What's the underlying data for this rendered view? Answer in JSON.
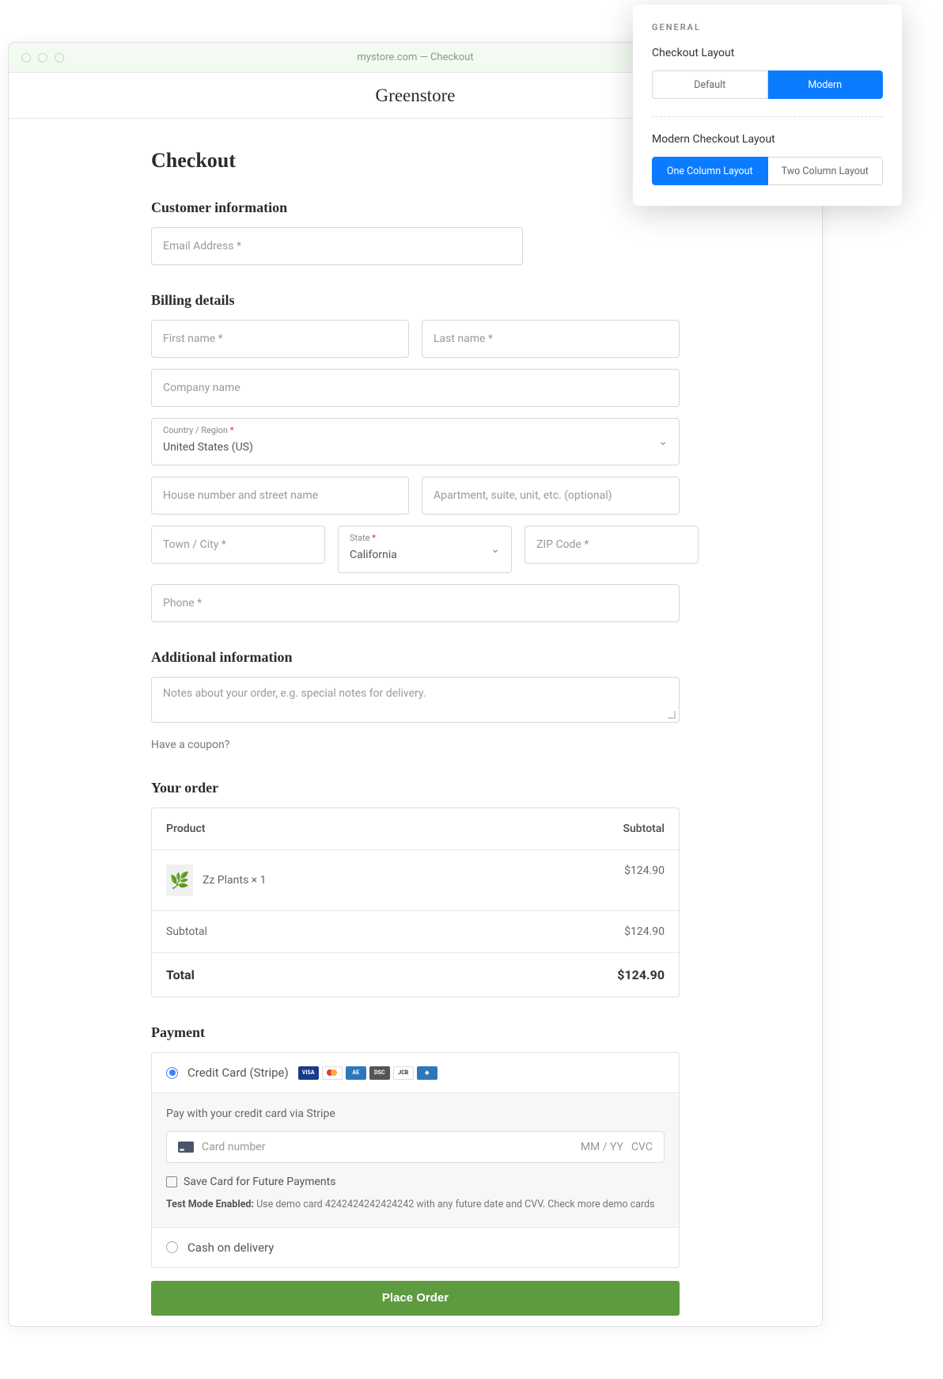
{
  "browser": {
    "url": "mystore.com — Checkout"
  },
  "store": {
    "name": "Greenstore"
  },
  "page": {
    "title": "Checkout"
  },
  "customer": {
    "heading": "Customer information",
    "email_placeholder": "Email Address *"
  },
  "billing": {
    "heading": "Billing details",
    "first_name": "First name *",
    "last_name": "Last name *",
    "company": "Company name",
    "country_label": "Country / Region",
    "country_value": "United States (US)",
    "street": "House number and street name",
    "apt": "Apartment, suite, unit, etc. (optional)",
    "city": "Town / City *",
    "state_label": "State",
    "state_value": "California",
    "zip": "ZIP Code *",
    "phone": "Phone *"
  },
  "additional": {
    "heading": "Additional information",
    "notes_placeholder": "Notes about your order, e.g. special notes for delivery."
  },
  "coupon": {
    "text": "Have a coupon?"
  },
  "order": {
    "heading": "Your order",
    "col_product": "Product",
    "col_subtotal": "Subtotal",
    "item_name": "Zz Plants × 1",
    "item_price": "$124.90",
    "subtotal_label": "Subtotal",
    "subtotal_value": "$124.90",
    "total_label": "Total",
    "total_value": "$124.90"
  },
  "payment": {
    "heading": "Payment",
    "cc_label": "Credit Card (Stripe)",
    "cc_desc": "Pay with your credit card via Stripe",
    "card_placeholder": "Card number",
    "expiry_placeholder": "MM / YY",
    "cvc_placeholder": "CVC",
    "save_label": "Save Card for Future Payments",
    "test_bold": "Test Mode Enabled:",
    "test_rest": " Use demo card 4242424242424242 with any future date and CVV. Check more demo cards",
    "cod_label": "Cash on delivery",
    "place_order": "Place Order"
  },
  "settings": {
    "general": "GENERAL",
    "layout_heading": "Checkout Layout",
    "default": "Default",
    "modern": "Modern",
    "modern_heading": "Modern Checkout Layout",
    "one_col": "One Column Layout",
    "two_col": "Two Column Layout"
  }
}
